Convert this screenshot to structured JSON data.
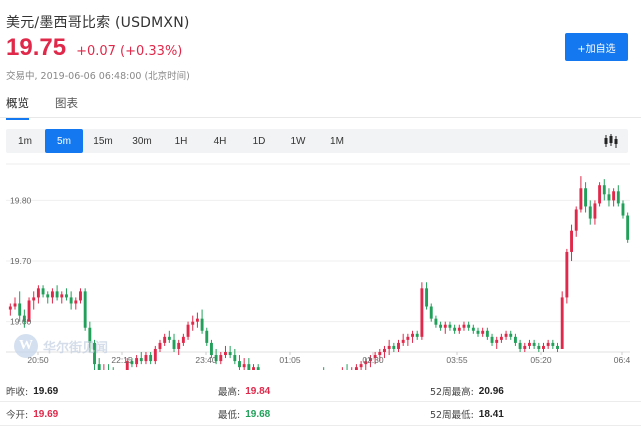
{
  "header": {
    "title": "美元/墨西哥比索 (USDMXN)",
    "price": "19.75",
    "change": "+0.07 (+0.33%)",
    "status": "交易中, 2019-06-06 06:48:00 (北京时间)",
    "add_button": "+加自选"
  },
  "view_tabs": [
    "概览",
    "图表"
  ],
  "periods": [
    "1m",
    "5m",
    "15m",
    "30m",
    "1H",
    "4H",
    "1D",
    "1W",
    "1M"
  ],
  "active_period": "5m",
  "watermark": "华尔街见闻",
  "colors": {
    "up": "#e0294a",
    "down": "#22a05a",
    "accent": "#1478f0"
  },
  "stats": {
    "prev_close": {
      "label": "昨收:",
      "value": "19.69"
    },
    "open": {
      "label": "今开:",
      "value": "19.69"
    },
    "high": {
      "label": "最高:",
      "value": "19.84"
    },
    "low": {
      "label": "最低:",
      "value": "19.68"
    },
    "w52_high": {
      "label": "52周最高:",
      "value": "20.96"
    },
    "w52_low": {
      "label": "52周最低:",
      "value": "18.41"
    }
  },
  "chart_data": {
    "type": "candlestick",
    "ylim": [
      19.55,
      19.86
    ],
    "y_ticks": [
      "19.80",
      "19.70",
      "19.60"
    ],
    "x_ticks": [
      "20:50",
      "22:15",
      "23:40",
      "01:05",
      "02:30",
      "03:55",
      "05:20",
      "06:4"
    ],
    "candles": [
      [
        19.62,
        19.63,
        19.61,
        19.625
      ],
      [
        19.625,
        19.64,
        19.62,
        19.63
      ],
      [
        19.63,
        19.65,
        19.6,
        19.61
      ],
      [
        19.61,
        19.62,
        19.59,
        19.6
      ],
      [
        19.6,
        19.64,
        19.6,
        19.635
      ],
      [
        19.635,
        19.65,
        19.62,
        19.64
      ],
      [
        19.64,
        19.66,
        19.63,
        19.655
      ],
      [
        19.655,
        19.66,
        19.64,
        19.645
      ],
      [
        19.645,
        19.65,
        19.63,
        19.64
      ],
      [
        19.64,
        19.655,
        19.63,
        19.65
      ],
      [
        19.65,
        19.66,
        19.635,
        19.64
      ],
      [
        19.64,
        19.65,
        19.63,
        19.645
      ],
      [
        19.645,
        19.655,
        19.635,
        19.64
      ],
      [
        19.64,
        19.65,
        19.62,
        19.63
      ],
      [
        19.63,
        19.64,
        19.62,
        19.635
      ],
      [
        19.635,
        19.655,
        19.63,
        19.65
      ],
      [
        19.65,
        19.655,
        19.585,
        19.59
      ],
      [
        19.59,
        19.6,
        19.55,
        19.565
      ],
      [
        19.565,
        19.57,
        19.52,
        19.53
      ],
      [
        19.53,
        19.54,
        19.5,
        19.51
      ],
      [
        19.51,
        19.53,
        19.5,
        19.52
      ],
      [
        19.52,
        19.53,
        19.51,
        19.515
      ],
      [
        19.515,
        19.525,
        19.505,
        19.51
      ],
      [
        19.51,
        19.52,
        19.5,
        19.505
      ],
      [
        19.505,
        19.52,
        19.495,
        19.515
      ],
      [
        19.515,
        19.54,
        19.51,
        19.535
      ],
      [
        19.535,
        19.54,
        19.525,
        19.53
      ],
      [
        19.53,
        19.545,
        19.525,
        19.54
      ],
      [
        19.54,
        19.55,
        19.53,
        19.535
      ],
      [
        19.535,
        19.55,
        19.53,
        19.545
      ],
      [
        19.545,
        19.55,
        19.53,
        19.535
      ],
      [
        19.535,
        19.56,
        19.53,
        19.555
      ],
      [
        19.555,
        19.57,
        19.55,
        19.565
      ],
      [
        19.565,
        19.58,
        19.56,
        19.575
      ],
      [
        19.575,
        19.585,
        19.565,
        19.57
      ],
      [
        19.57,
        19.58,
        19.55,
        19.555
      ],
      [
        19.555,
        19.57,
        19.545,
        19.565
      ],
      [
        19.565,
        19.58,
        19.56,
        19.575
      ],
      [
        19.575,
        19.6,
        19.57,
        19.595
      ],
      [
        19.595,
        19.61,
        19.585,
        19.6
      ],
      [
        19.6,
        19.615,
        19.59,
        19.605
      ],
      [
        19.605,
        19.62,
        19.58,
        19.585
      ],
      [
        19.585,
        19.59,
        19.56,
        19.565
      ],
      [
        19.565,
        19.57,
        19.54,
        19.545
      ],
      [
        19.545,
        19.555,
        19.53,
        19.535
      ],
      [
        19.535,
        19.55,
        19.53,
        19.545
      ],
      [
        19.545,
        19.56,
        19.54,
        19.55
      ],
      [
        19.55,
        19.56,
        19.54,
        19.545
      ],
      [
        19.545,
        19.555,
        19.53,
        19.535
      ],
      [
        19.535,
        19.545,
        19.52,
        19.525
      ],
      [
        19.525,
        19.54,
        19.52,
        19.53
      ],
      [
        19.53,
        19.54,
        19.515,
        19.52
      ],
      [
        19.52,
        19.53,
        19.51,
        19.525
      ],
      [
        19.525,
        19.53,
        19.505,
        19.51
      ],
      [
        19.51,
        19.52,
        19.495,
        19.5
      ],
      [
        19.5,
        19.51,
        19.48,
        19.485
      ],
      [
        19.485,
        19.5,
        19.475,
        19.49
      ],
      [
        19.49,
        19.51,
        19.485,
        19.505
      ],
      [
        19.505,
        19.51,
        19.48,
        19.485
      ],
      [
        19.485,
        19.5,
        19.48,
        19.495
      ],
      [
        19.495,
        19.51,
        19.49,
        19.5
      ],
      [
        19.5,
        19.51,
        19.49,
        19.495
      ],
      [
        19.495,
        19.505,
        19.485,
        19.49
      ],
      [
        19.49,
        19.5,
        19.485,
        19.495
      ],
      [
        19.495,
        19.51,
        19.49,
        19.505
      ],
      [
        19.505,
        19.515,
        19.5,
        19.51
      ],
      [
        19.51,
        19.52,
        19.505,
        19.515
      ],
      [
        19.515,
        19.525,
        19.505,
        19.51
      ],
      [
        19.51,
        19.52,
        19.5,
        19.515
      ],
      [
        19.515,
        19.52,
        19.505,
        19.51
      ],
      [
        19.51,
        19.52,
        19.505,
        19.515
      ],
      [
        19.515,
        19.525,
        19.51,
        19.52
      ],
      [
        19.52,
        19.53,
        19.51,
        19.515
      ],
      [
        19.515,
        19.525,
        19.505,
        19.52
      ],
      [
        19.52,
        19.53,
        19.51,
        19.525
      ],
      [
        19.525,
        19.535,
        19.52,
        19.53
      ],
      [
        19.53,
        19.54,
        19.52,
        19.535
      ],
      [
        19.535,
        19.545,
        19.525,
        19.54
      ],
      [
        19.54,
        19.55,
        19.53,
        19.545
      ],
      [
        19.545,
        19.555,
        19.535,
        19.55
      ],
      [
        19.55,
        19.56,
        19.54,
        19.555
      ],
      [
        19.555,
        19.57,
        19.545,
        19.56
      ],
      [
        19.56,
        19.565,
        19.55,
        19.555
      ],
      [
        19.555,
        19.57,
        19.55,
        19.565
      ],
      [
        19.565,
        19.58,
        19.56,
        19.57
      ],
      [
        19.57,
        19.58,
        19.56,
        19.575
      ],
      [
        19.575,
        19.585,
        19.565,
        19.58
      ],
      [
        19.58,
        19.585,
        19.57,
        19.575
      ],
      [
        19.575,
        19.665,
        19.57,
        19.655
      ],
      [
        19.655,
        19.665,
        19.62,
        19.625
      ],
      [
        19.625,
        19.63,
        19.6,
        19.605
      ],
      [
        19.605,
        19.61,
        19.59,
        19.595
      ],
      [
        19.595,
        19.6,
        19.585,
        19.59
      ],
      [
        19.59,
        19.6,
        19.58,
        19.595
      ],
      [
        19.595,
        19.6,
        19.585,
        19.59
      ],
      [
        19.59,
        19.595,
        19.58,
        19.585
      ],
      [
        19.585,
        19.595,
        19.58,
        19.59
      ],
      [
        19.59,
        19.6,
        19.585,
        19.595
      ],
      [
        19.595,
        19.6,
        19.585,
        19.59
      ],
      [
        19.59,
        19.595,
        19.58,
        19.585
      ],
      [
        19.585,
        19.59,
        19.575,
        19.58
      ],
      [
        19.58,
        19.59,
        19.575,
        19.585
      ],
      [
        19.585,
        19.59,
        19.57,
        19.575
      ],
      [
        19.575,
        19.58,
        19.56,
        19.565
      ],
      [
        19.565,
        19.575,
        19.555,
        19.57
      ],
      [
        19.57,
        19.58,
        19.565,
        19.575
      ],
      [
        19.575,
        19.585,
        19.57,
        19.58
      ],
      [
        19.58,
        19.585,
        19.57,
        19.575
      ],
      [
        19.575,
        19.58,
        19.56,
        19.565
      ],
      [
        19.565,
        19.57,
        19.55,
        19.555
      ],
      [
        19.555,
        19.565,
        19.55,
        19.56
      ],
      [
        19.56,
        19.57,
        19.555,
        19.565
      ],
      [
        19.565,
        19.57,
        19.555,
        19.56
      ],
      [
        19.56,
        19.565,
        19.55,
        19.555
      ],
      [
        19.555,
        19.565,
        19.55,
        19.56
      ],
      [
        19.56,
        19.57,
        19.555,
        19.565
      ],
      [
        19.565,
        19.57,
        19.555,
        19.56
      ],
      [
        19.56,
        19.565,
        19.55,
        19.555
      ],
      [
        19.555,
        19.65,
        19.555,
        19.64
      ],
      [
        19.64,
        19.72,
        19.63,
        19.715
      ],
      [
        19.715,
        19.76,
        19.7,
        19.75
      ],
      [
        19.75,
        19.79,
        19.74,
        19.785
      ],
      [
        19.785,
        19.84,
        19.78,
        19.82
      ],
      [
        19.82,
        19.83,
        19.78,
        19.79
      ],
      [
        19.79,
        19.8,
        19.76,
        19.77
      ],
      [
        19.77,
        19.8,
        19.76,
        19.795
      ],
      [
        19.795,
        19.83,
        19.79,
        19.825
      ],
      [
        19.825,
        19.835,
        19.8,
        19.81
      ],
      [
        19.81,
        19.82,
        19.79,
        19.8
      ],
      [
        19.8,
        19.82,
        19.79,
        19.815
      ],
      [
        19.815,
        19.825,
        19.79,
        19.795
      ],
      [
        19.795,
        19.8,
        19.77,
        19.775
      ],
      [
        19.775,
        19.78,
        19.73,
        19.735
      ]
    ]
  }
}
